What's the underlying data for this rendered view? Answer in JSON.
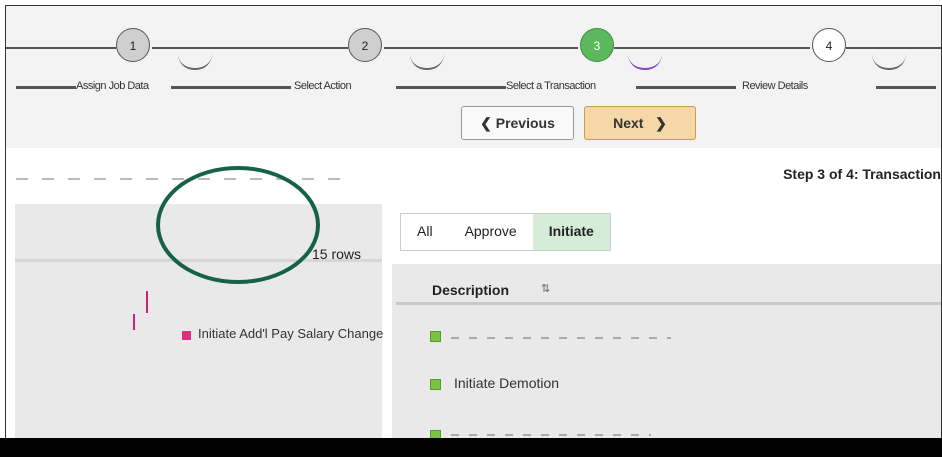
{
  "stepper": {
    "steps": [
      {
        "number": "1",
        "label": "Assign Job Data",
        "state": "done"
      },
      {
        "number": "2",
        "label": "Select Action",
        "state": "done"
      },
      {
        "number": "3",
        "label": "Select a Transaction",
        "state": "current"
      },
      {
        "number": "4",
        "label": "Review Details",
        "state": "future"
      }
    ]
  },
  "nav": {
    "previous_label": "Previous",
    "next_label": "Next",
    "previous_icon": "chevron-left-icon",
    "next_icon": "chevron-right-icon"
  },
  "page": {
    "step_title": "Step 3 of 4: Transaction"
  },
  "left": {
    "rows_count": "15 rows",
    "first_item": "Initiate Add'l Pay Salary Change"
  },
  "right": {
    "tabs": [
      {
        "label": "All",
        "active": false
      },
      {
        "label": "Approve",
        "active": false
      },
      {
        "label": "Initiate",
        "active": true
      }
    ],
    "column_header": "Description",
    "rows": [
      {
        "label": "Initiate Demotion"
      }
    ]
  },
  "colors": {
    "current_step": "#5cb85c",
    "next_button": "#f6d7a8",
    "active_tab": "#d4ecd8",
    "annotation": "#17614a",
    "checkbox": "#7bc142"
  }
}
